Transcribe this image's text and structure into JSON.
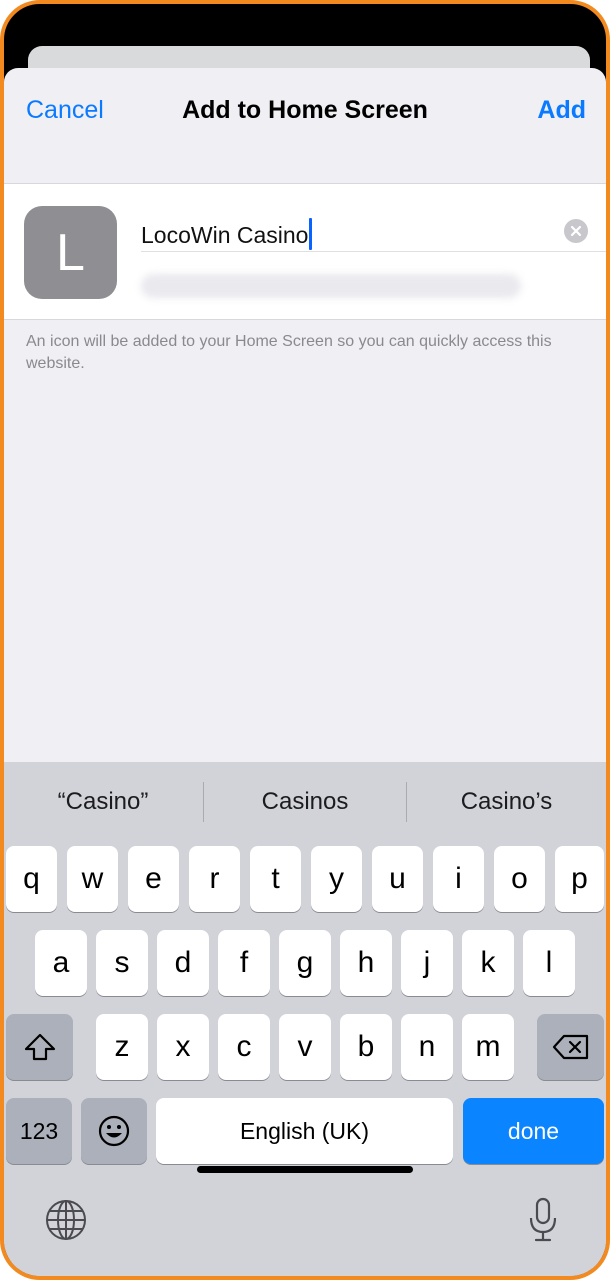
{
  "nav": {
    "cancel_label": "Cancel",
    "title": "Add to Home Screen",
    "add_label": "Add"
  },
  "bookmark": {
    "icon_letter": "L",
    "name_value": "LocoWin Casino",
    "hint": "An icon will be added to your Home Screen so you can quickly access this website."
  },
  "keyboard": {
    "suggestions": [
      "“Casino”",
      "Casinos",
      "Casino’s"
    ],
    "row1": [
      "q",
      "w",
      "e",
      "r",
      "t",
      "y",
      "u",
      "i",
      "o",
      "p"
    ],
    "row2": [
      "a",
      "s",
      "d",
      "f",
      "g",
      "h",
      "j",
      "k",
      "l"
    ],
    "row3": [
      "z",
      "x",
      "c",
      "v",
      "b",
      "n",
      "m"
    ],
    "numbers_label": "123",
    "space_label": "English (UK)",
    "return_label": "done",
    "icons": [
      "shift-icon",
      "backspace-icon",
      "emoji-icon",
      "globe-icon",
      "microphone-icon",
      "clear-text-icon"
    ]
  },
  "colors": {
    "accent": "#0a7aff",
    "done_key": "#0a84ff",
    "frame": "#F28A1F",
    "sheet_bg": "#efeff4",
    "keyboard_bg": "#d1d3d9"
  }
}
